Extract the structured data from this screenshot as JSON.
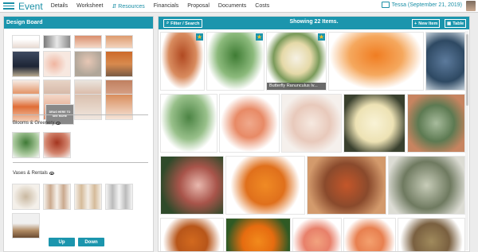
{
  "app": {
    "brand": "Event"
  },
  "nav": [
    {
      "label": "Details"
    },
    {
      "label": "Worksheet"
    },
    {
      "label": "Resources"
    },
    {
      "label": "Financials"
    },
    {
      "label": "Proposal"
    },
    {
      "label": "Documents"
    },
    {
      "label": "Costs"
    }
  ],
  "user": {
    "label": "Tessa (September 21, 2019)"
  },
  "left": {
    "title": "Design Board",
    "placeholder_card": "DRAG HERE TO SEE MORE",
    "sections": [
      {
        "label": "Blooms & Greenery"
      },
      {
        "label": "Vases & Rentals"
      }
    ],
    "up": "Up",
    "down": "Down"
  },
  "right": {
    "filter": "Filter / Search",
    "showing": "Showing 22 Items.",
    "new_item": "New Item",
    "table": "Table",
    "caption": "Butterfly Ranunculus Iv...",
    "star": "★"
  },
  "colors": {
    "accent": "#1b95ad",
    "star": "#f2c027"
  }
}
